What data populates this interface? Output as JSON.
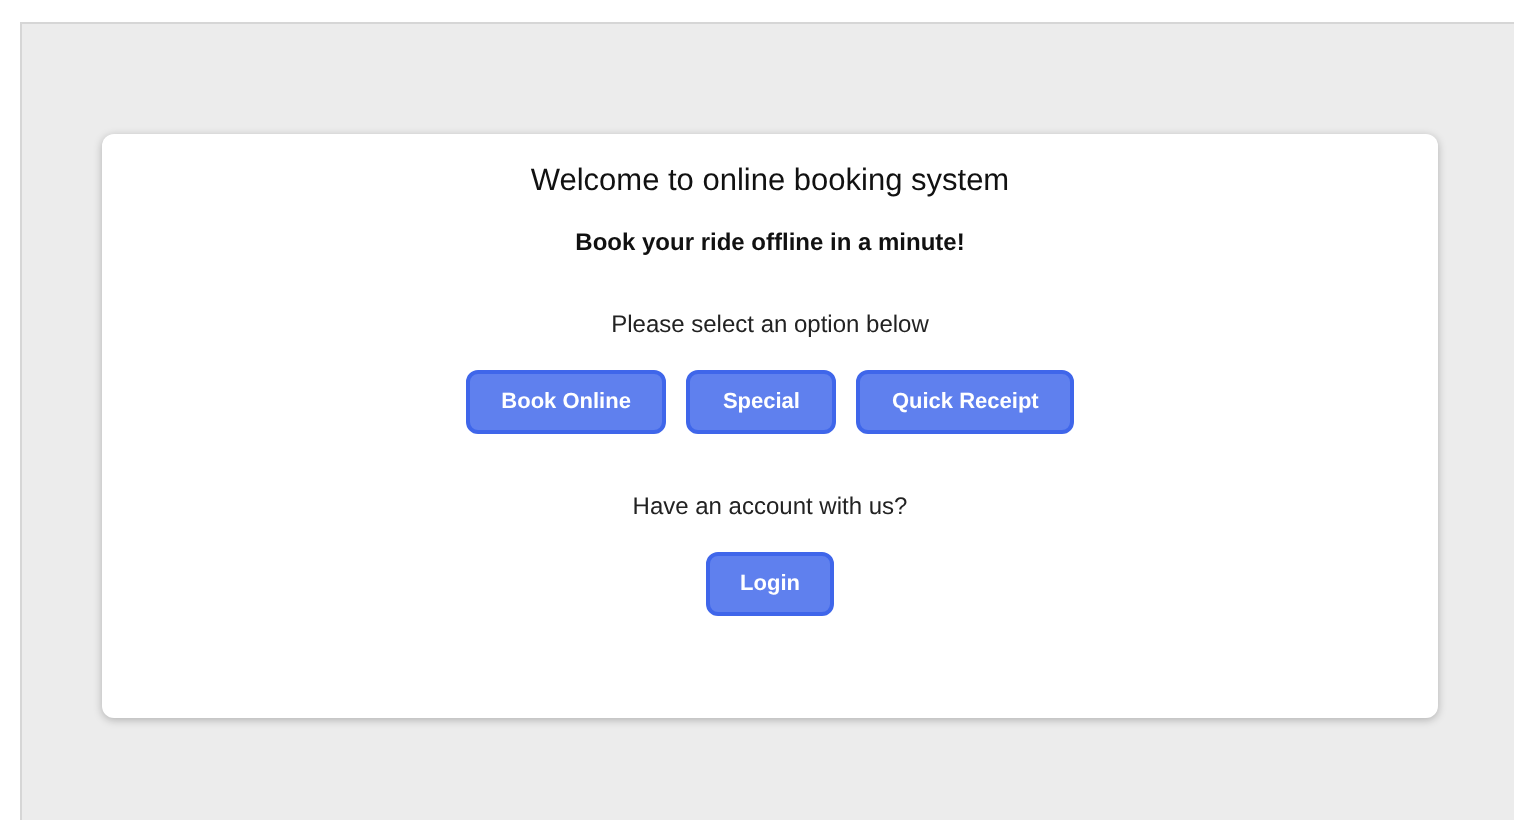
{
  "card": {
    "title": "Welcome to online booking system",
    "subtitle": "Book your ride offline in a minute!",
    "prompt": "Please select an option below",
    "options": [
      "Book Online",
      "Special",
      "Quick Receipt"
    ],
    "account_prompt": "Have an account with us?",
    "login_button": "Login"
  }
}
